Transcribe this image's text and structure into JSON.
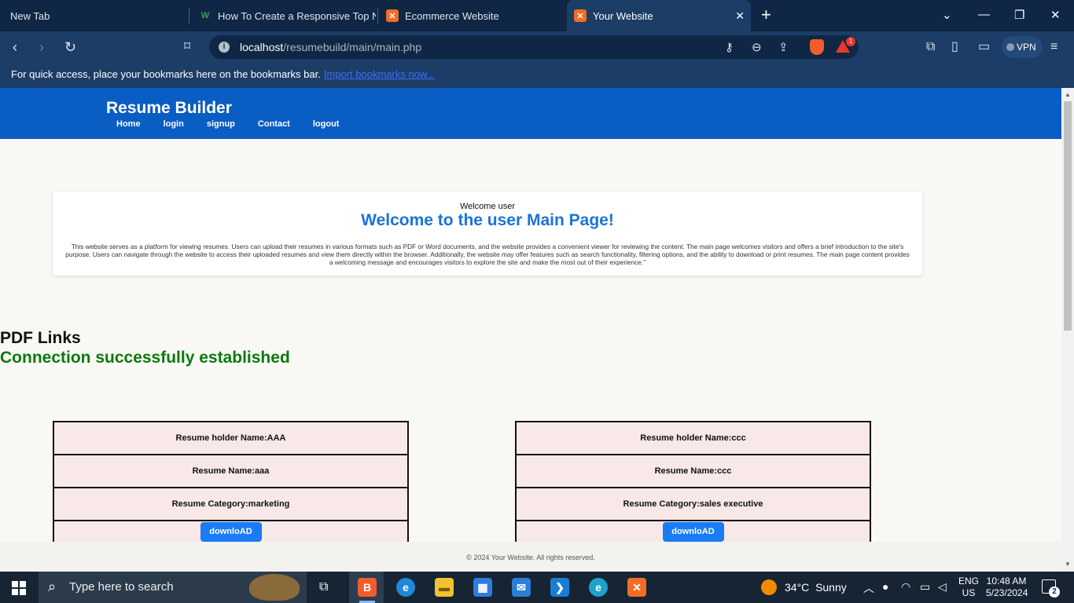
{
  "browser": {
    "tabs": [
      {
        "label": "New Tab",
        "favicon": ""
      },
      {
        "label": "How To Create a Responsive Top Nav",
        "favicon": "W"
      },
      {
        "label": "Ecommerce Website",
        "favicon": "xampp"
      },
      {
        "label": "Your Website",
        "favicon": "xampp",
        "active": true
      }
    ],
    "url_host": "localhost",
    "url_path": "/resumebuild/main/main.php",
    "shield_badge": "1",
    "vpn_label": "VPN",
    "bookmarks_text": "For quick access, place your bookmarks here on the bookmarks bar.",
    "bookmarks_link": "Import bookmarks now..."
  },
  "site": {
    "title": "Resume Builder",
    "nav": [
      "Home",
      "login",
      "signup",
      "Contact",
      "logout"
    ],
    "welcome_small": "Welcome user",
    "welcome_heading": "Welcome to the user Main Page!",
    "welcome_description": "This website serves as a platform for viewing resumes. Users can upload their resumes in various formats such as PDF or Word documents, and the website provides a convenient viewer for reviewing the content. The main page welcomes visitors and offers a brief introduction to the site's purpose. Users can navigate through the website to access their uploaded resumes and view them directly within the browser. Additionally, the website may offer features such as search functionality, filtering options, and the ability to download or print resumes. The main page content provides a welcoming message and encourages visitors to explore the site and make the most out of their experience.\"",
    "pdf_links_title": "PDF Links",
    "connection_message": "Connection successfully established",
    "resumes": [
      {
        "holder": "Resume holder Name:AAA",
        "name": "Resume Name:aaa",
        "category": "Resume Category:marketing",
        "button": "downloAD"
      },
      {
        "holder": "Resume holder Name:ccc",
        "name": "Resume Name:ccc",
        "category": "Resume Category:sales executive",
        "button": "downloAD"
      }
    ],
    "footer": "© 2024 Your Website. All rights reserved."
  },
  "taskbar": {
    "search_placeholder": "Type here to search",
    "weather_temp": "34°C",
    "weather_text": "Sunny",
    "lang_1": "ENG",
    "lang_2": "US",
    "time": "10:48 AM",
    "date": "5/23/2024",
    "notifications": "2"
  },
  "colors": {
    "site_header": "#0a5dc2",
    "welcome_heading": "#1a73d9",
    "connection": "#0b7a0b",
    "card_bg": "#f8e8e8",
    "button": "#1a7cf5"
  }
}
